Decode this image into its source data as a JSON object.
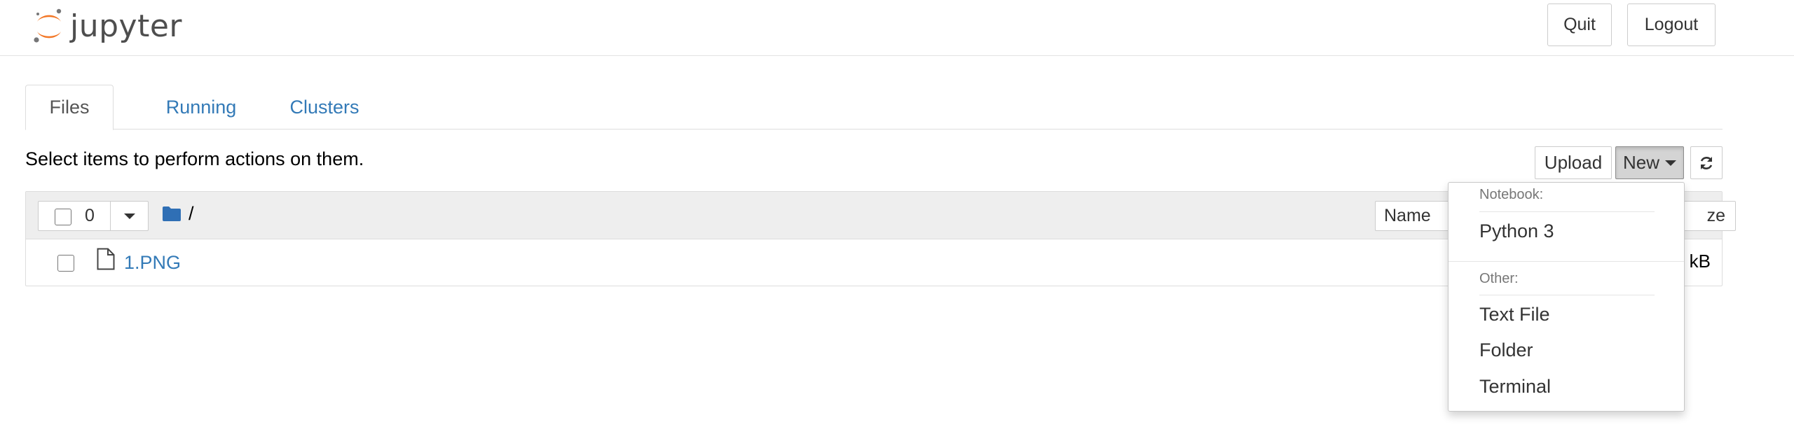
{
  "header": {
    "logo_text": "jupyter",
    "quit_label": "Quit",
    "logout_label": "Logout"
  },
  "tabs": [
    {
      "label": "Files",
      "active": true
    },
    {
      "label": "Running",
      "active": false
    },
    {
      "label": "Clusters",
      "active": false
    }
  ],
  "toolbar": {
    "hint": "Select items to perform actions on them.",
    "upload_label": "Upload",
    "new_label": "New",
    "refresh_icon": "refresh-icon"
  },
  "file_list": {
    "selected_count": "0",
    "breadcrumb_root": "/",
    "sort_name_label": "Name",
    "sort_size_label": "ze",
    "rows": [
      {
        "name": "1.PNG",
        "size": "kB",
        "icon": "file-icon"
      }
    ]
  },
  "new_menu": {
    "notebook_header": "Notebook:",
    "notebook_items": [
      "Python 3"
    ],
    "other_header": "Other:",
    "other_items": [
      "Text File",
      "Folder",
      "Terminal"
    ]
  },
  "colors": {
    "link": "#337ab7",
    "brand_orange": "#f37726",
    "logo_gray": "#767677"
  }
}
